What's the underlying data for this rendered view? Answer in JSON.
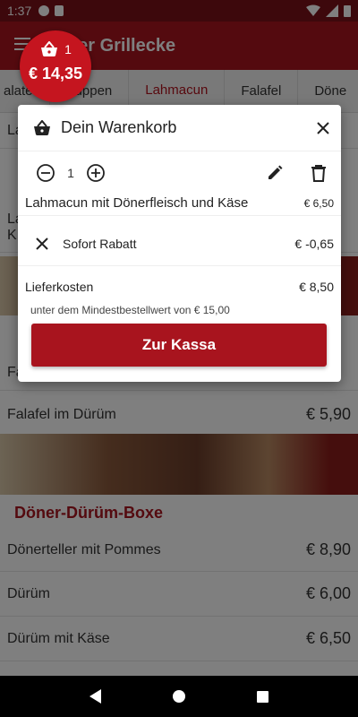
{
  "status_bar": {
    "time": "1:37"
  },
  "app_bar": {
    "title_visible": "…ser Grillecke"
  },
  "cart_badge": {
    "count": "1",
    "total": "€ 14,35"
  },
  "tabs": [
    {
      "label": "alate"
    },
    {
      "label": "Suppen"
    },
    {
      "label": "Lahmacun"
    },
    {
      "label": "Falafel"
    },
    {
      "label": "Döne"
    }
  ],
  "background": {
    "partial_rows": [
      "La",
      "La",
      "K"
    ],
    "row_falafel_partial": "Fa",
    "falafel_duerum": {
      "label": "Falafel im Dürüm",
      "price": "€ 5,90"
    },
    "section_title": "Döner-Dürüm-Boxe",
    "items": [
      {
        "label": "Dönerteller mit Pommes",
        "price": "€ 8,90"
      },
      {
        "label": "Dürüm",
        "price": "€ 6,00"
      },
      {
        "label": "Dürüm mit Käse",
        "price": "€ 6,50"
      }
    ]
  },
  "dialog": {
    "title": "Dein Warenkorb",
    "quantity": "1",
    "item_name": "Lahmacun mit Dönerfleisch und Käse",
    "item_price": "€ 6,50",
    "rabatt_label": "Sofort Rabatt",
    "rabatt_amount": "€ -0,65",
    "fee_label": "Lieferkosten",
    "fee_amount": "€ 8,50",
    "min_note": "unter dem Mindestbestellwert von € 15,00",
    "checkout_label": "Zur Kassa"
  },
  "colors": {
    "brand": "#a8141e",
    "status_bar": "#7a1018",
    "badge": "#c5151f"
  },
  "icons": {
    "cart": "basket-icon",
    "close": "close-icon",
    "minus": "minus-circle-icon",
    "plus": "plus-circle-icon",
    "edit": "pencil-icon",
    "delete": "trash-icon",
    "remove_discount": "close-icon"
  }
}
